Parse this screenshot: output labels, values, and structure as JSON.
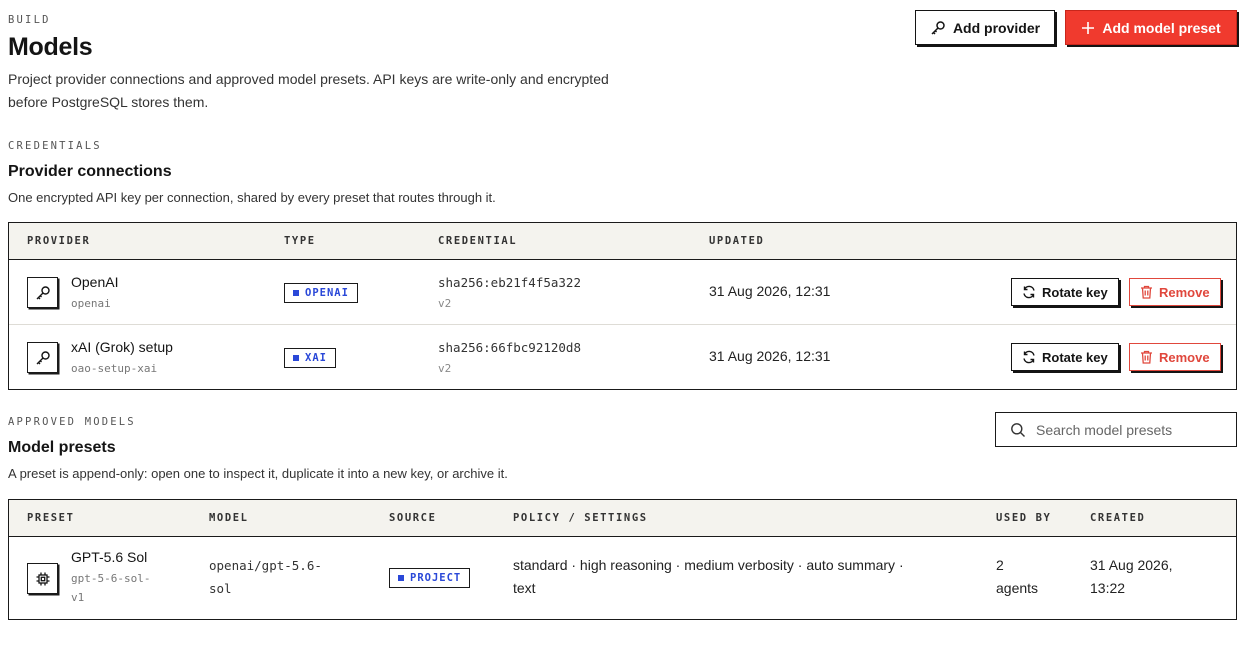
{
  "header": {
    "eyebrow": "BUILD",
    "title": "Models",
    "description": "Project provider connections and approved model presets. API keys are write-only and encrypted before PostgreSQL stores them.",
    "add_provider_label": "Add provider",
    "add_preset_label": "Add model preset"
  },
  "credentials": {
    "eyebrow": "CREDENTIALS",
    "title": "Provider connections",
    "subtitle": "One encrypted API key per connection, shared by every preset that routes through it.",
    "columns": {
      "provider": "PROVIDER",
      "type": "TYPE",
      "credential": "CREDENTIAL",
      "updated": "UPDATED"
    },
    "rows": [
      {
        "name": "OpenAI",
        "slug": "openai",
        "type": "OPENAI",
        "credential": "sha256:eb21f4f5a322",
        "version": "v2",
        "updated": "31 Aug 2026, 12:31",
        "rotate_label": "Rotate key",
        "remove_label": "Remove"
      },
      {
        "name": "xAI (Grok) setup",
        "slug": "oao-setup-xai",
        "type": "XAI",
        "credential": "sha256:66fbc92120d8",
        "version": "v2",
        "updated": "31 Aug 2026, 12:31",
        "rotate_label": "Rotate key",
        "remove_label": "Remove"
      }
    ]
  },
  "models": {
    "eyebrow": "APPROVED MODELS",
    "title": "Model presets",
    "subtitle": "A preset is append-only: open one to inspect it, duplicate it into a new key, or archive it.",
    "search_placeholder": "Search model presets",
    "columns": {
      "preset": "PRESET",
      "model": "MODEL",
      "source": "SOURCE",
      "policy": "POLICY / SETTINGS",
      "used_by": "USED BY",
      "created": "CREATED"
    },
    "rows": [
      {
        "name": "GPT-5.6 Sol",
        "slug_line1": "gpt-5-6-sol-",
        "slug_line2": "v1",
        "model_line1": "openai/gpt-5.6-",
        "model_line2": "sol",
        "source": "PROJECT",
        "policy_line1": "standard · high reasoning · medium verbosity · auto summary ·",
        "policy_line2": "text",
        "used_by_line1": "2",
        "used_by_line2": "agents",
        "created_line1": "31 Aug 2026,",
        "created_line2": "13:22"
      }
    ]
  },
  "colors": {
    "accent": "#f03a2e",
    "badge_blue": "#2a48d8",
    "danger": "#e0473c",
    "header_bg": "#f4f3ee"
  }
}
